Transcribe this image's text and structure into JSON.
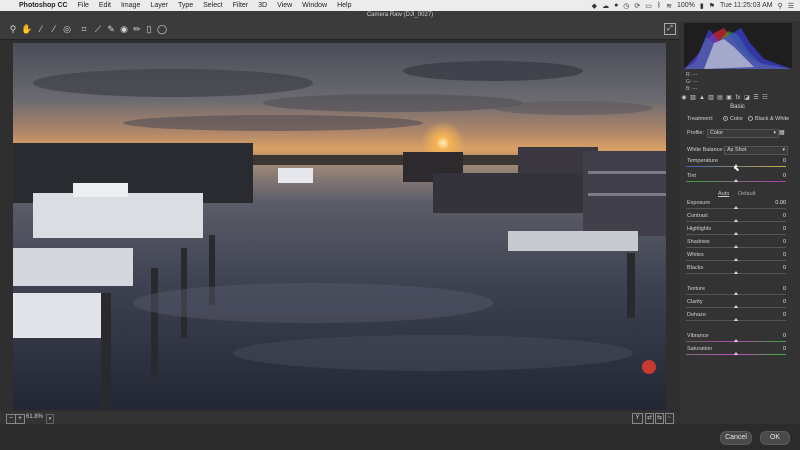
{
  "menubar": {
    "app": "Photoshop CC",
    "items": [
      "File",
      "Edit",
      "Image",
      "Layer",
      "Type",
      "Select",
      "Filter",
      "3D",
      "View",
      "Window",
      "Help"
    ],
    "battery": "100%",
    "clock": "Tue 11:25:03 AM"
  },
  "window": {
    "title": "Camera Raw (DJI_0027)"
  },
  "tools": [
    "zoom-tool",
    "hand-tool",
    "white-balance-tool",
    "color-sampler-tool",
    "targeted-adjustment-tool",
    "crop-tool",
    "straighten-tool",
    "spot-removal-tool",
    "red-eye-tool",
    "adjustment-brush-tool",
    "graduated-filter-tool",
    "radial-filter-tool"
  ],
  "histogram": {
    "r_label": "R:",
    "g_label": "G:",
    "b_label": "B:",
    "r": "---",
    "g": "---",
    "b": "---"
  },
  "panel": {
    "section_title": "Basic",
    "treatment_label": "Treatment:",
    "treatment_color": "Color",
    "treatment_bw": "Black & White",
    "profile_label": "Profile:",
    "profile_value": "Color",
    "wb_label": "White Balance:",
    "wb_value": "As Shot",
    "auto": "Auto",
    "default": "Default",
    "sliders": [
      {
        "label": "Temperature",
        "value": "0",
        "pos": 0.5
      },
      {
        "label": "Tint",
        "value": "0",
        "pos": 0.5
      },
      {
        "label": "Exposure",
        "value": "0.00",
        "pos": 0.5
      },
      {
        "label": "Contrast",
        "value": "0",
        "pos": 0.5
      },
      {
        "label": "Highlights",
        "value": "0",
        "pos": 0.5
      },
      {
        "label": "Shadows",
        "value": "0",
        "pos": 0.5
      },
      {
        "label": "Whites",
        "value": "0",
        "pos": 0.5
      },
      {
        "label": "Blacks",
        "value": "0",
        "pos": 0.5
      },
      {
        "label": "Texture",
        "value": "0",
        "pos": 0.5
      },
      {
        "label": "Clarity",
        "value": "0",
        "pos": 0.5
      },
      {
        "label": "Dehaze",
        "value": "0",
        "pos": 0.5
      },
      {
        "label": "Vibrance",
        "value": "0",
        "pos": 0.5
      },
      {
        "label": "Saturation",
        "value": "0",
        "pos": 0.5
      }
    ]
  },
  "statusbar": {
    "zoom": "61.8%",
    "view_y": "Y"
  },
  "footer": {
    "cancel": "Cancel",
    "ok": "OK"
  },
  "colors": {
    "accent": "#3c3c3c",
    "panel_bg": "#333333"
  }
}
